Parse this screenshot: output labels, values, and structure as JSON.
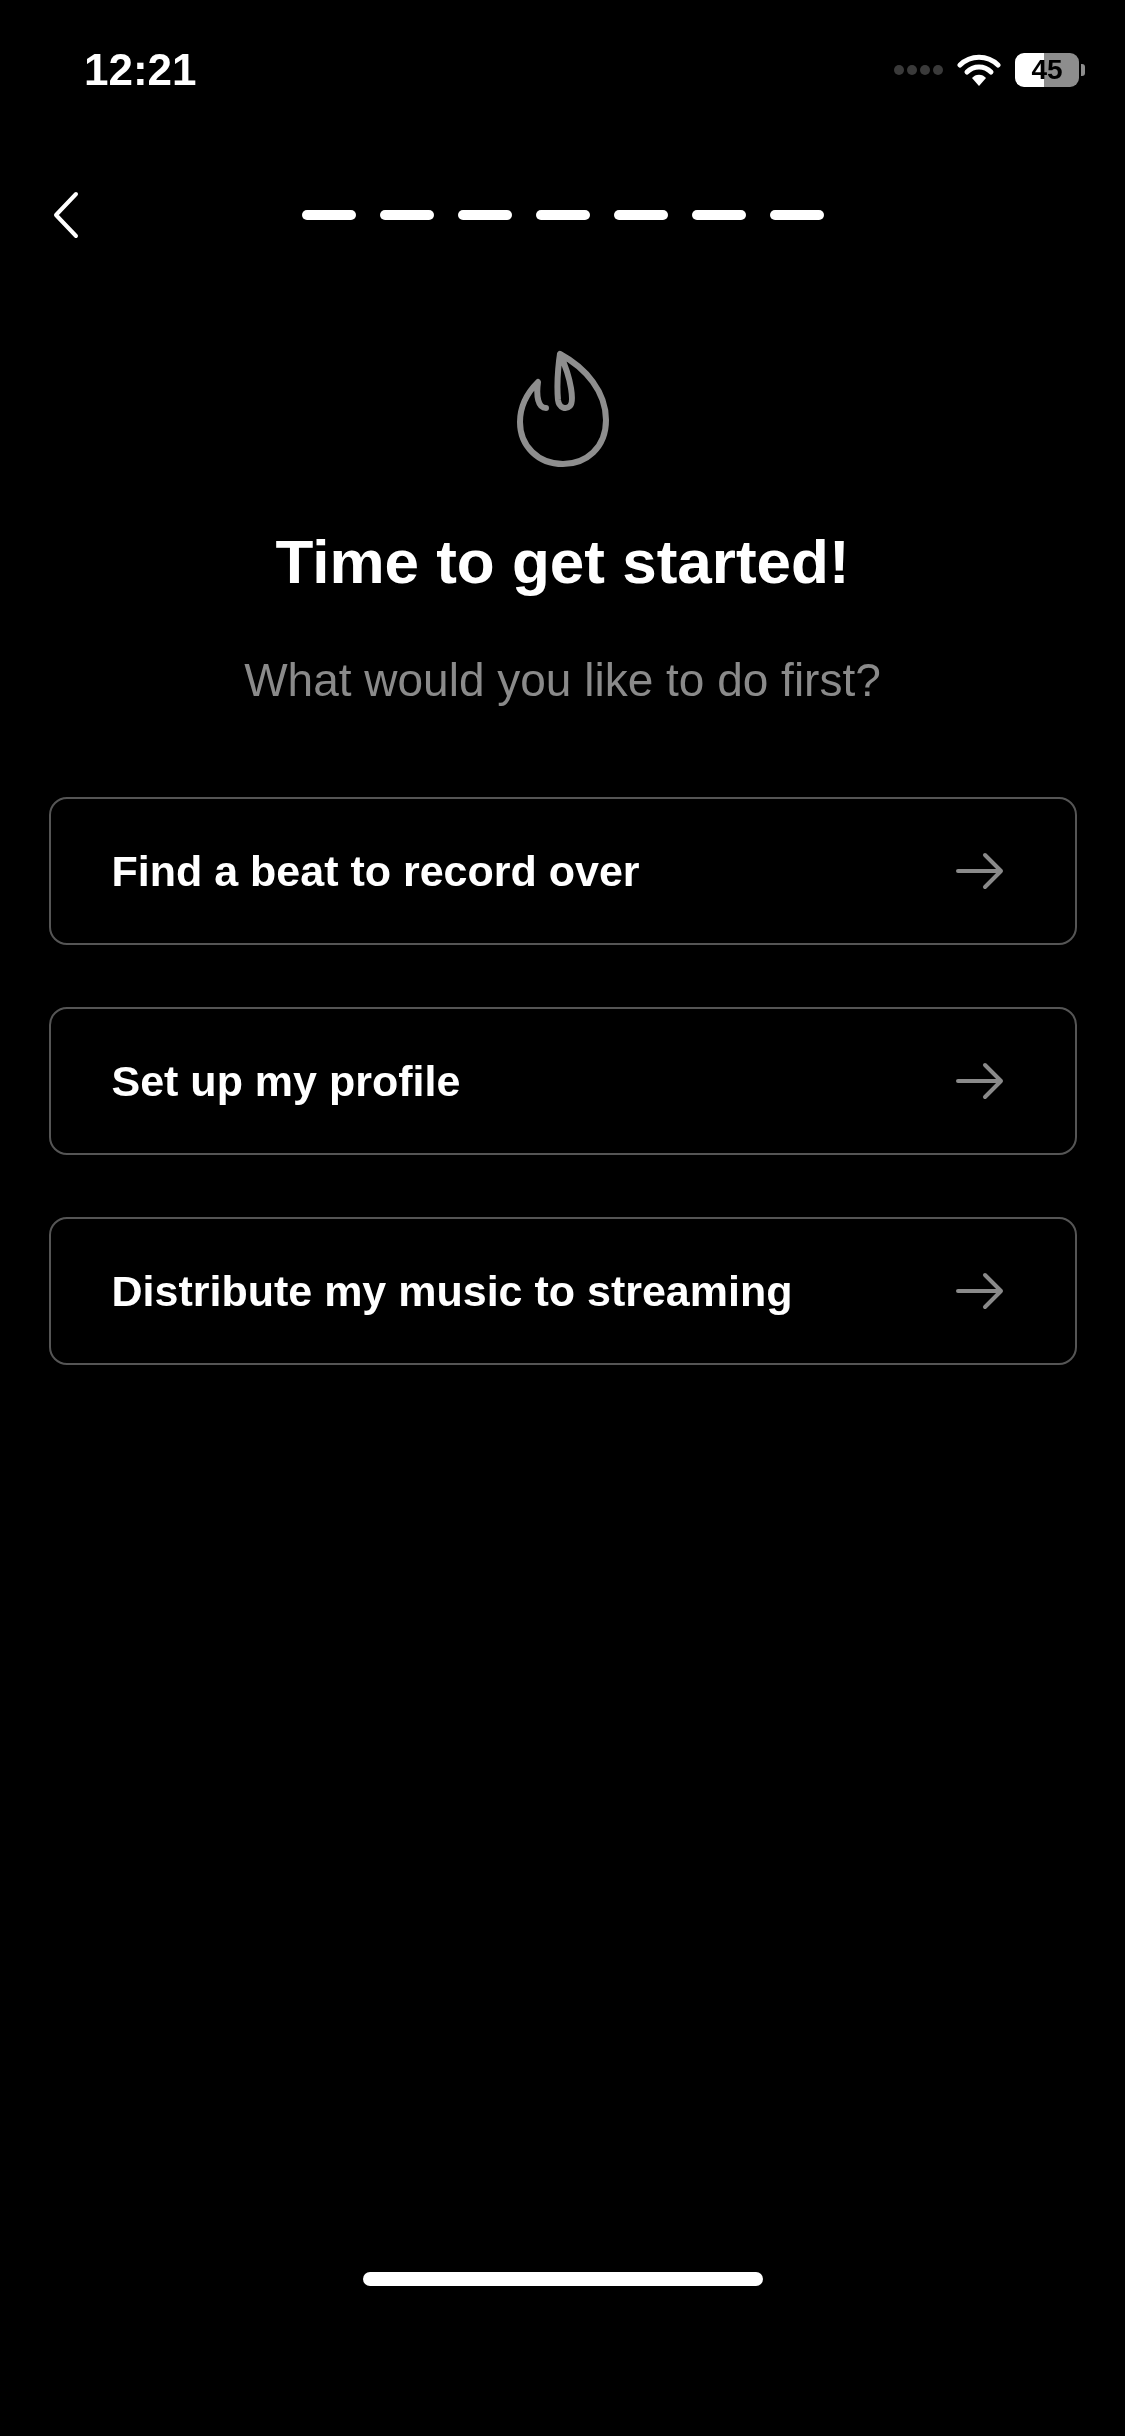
{
  "status_bar": {
    "time": "12:21",
    "battery": "45"
  },
  "progress_steps": [
    {
      "filled": true
    },
    {
      "filled": true
    },
    {
      "filled": true
    },
    {
      "filled": true
    },
    {
      "filled": true
    },
    {
      "filled": true
    },
    {
      "filled": true
    }
  ],
  "title": "Time to get started!",
  "subtitle": "What would you like to do first?",
  "options": [
    {
      "label": "Find a beat to record over"
    },
    {
      "label": "Set up my profile"
    },
    {
      "label": "Distribute my music to streaming"
    }
  ]
}
